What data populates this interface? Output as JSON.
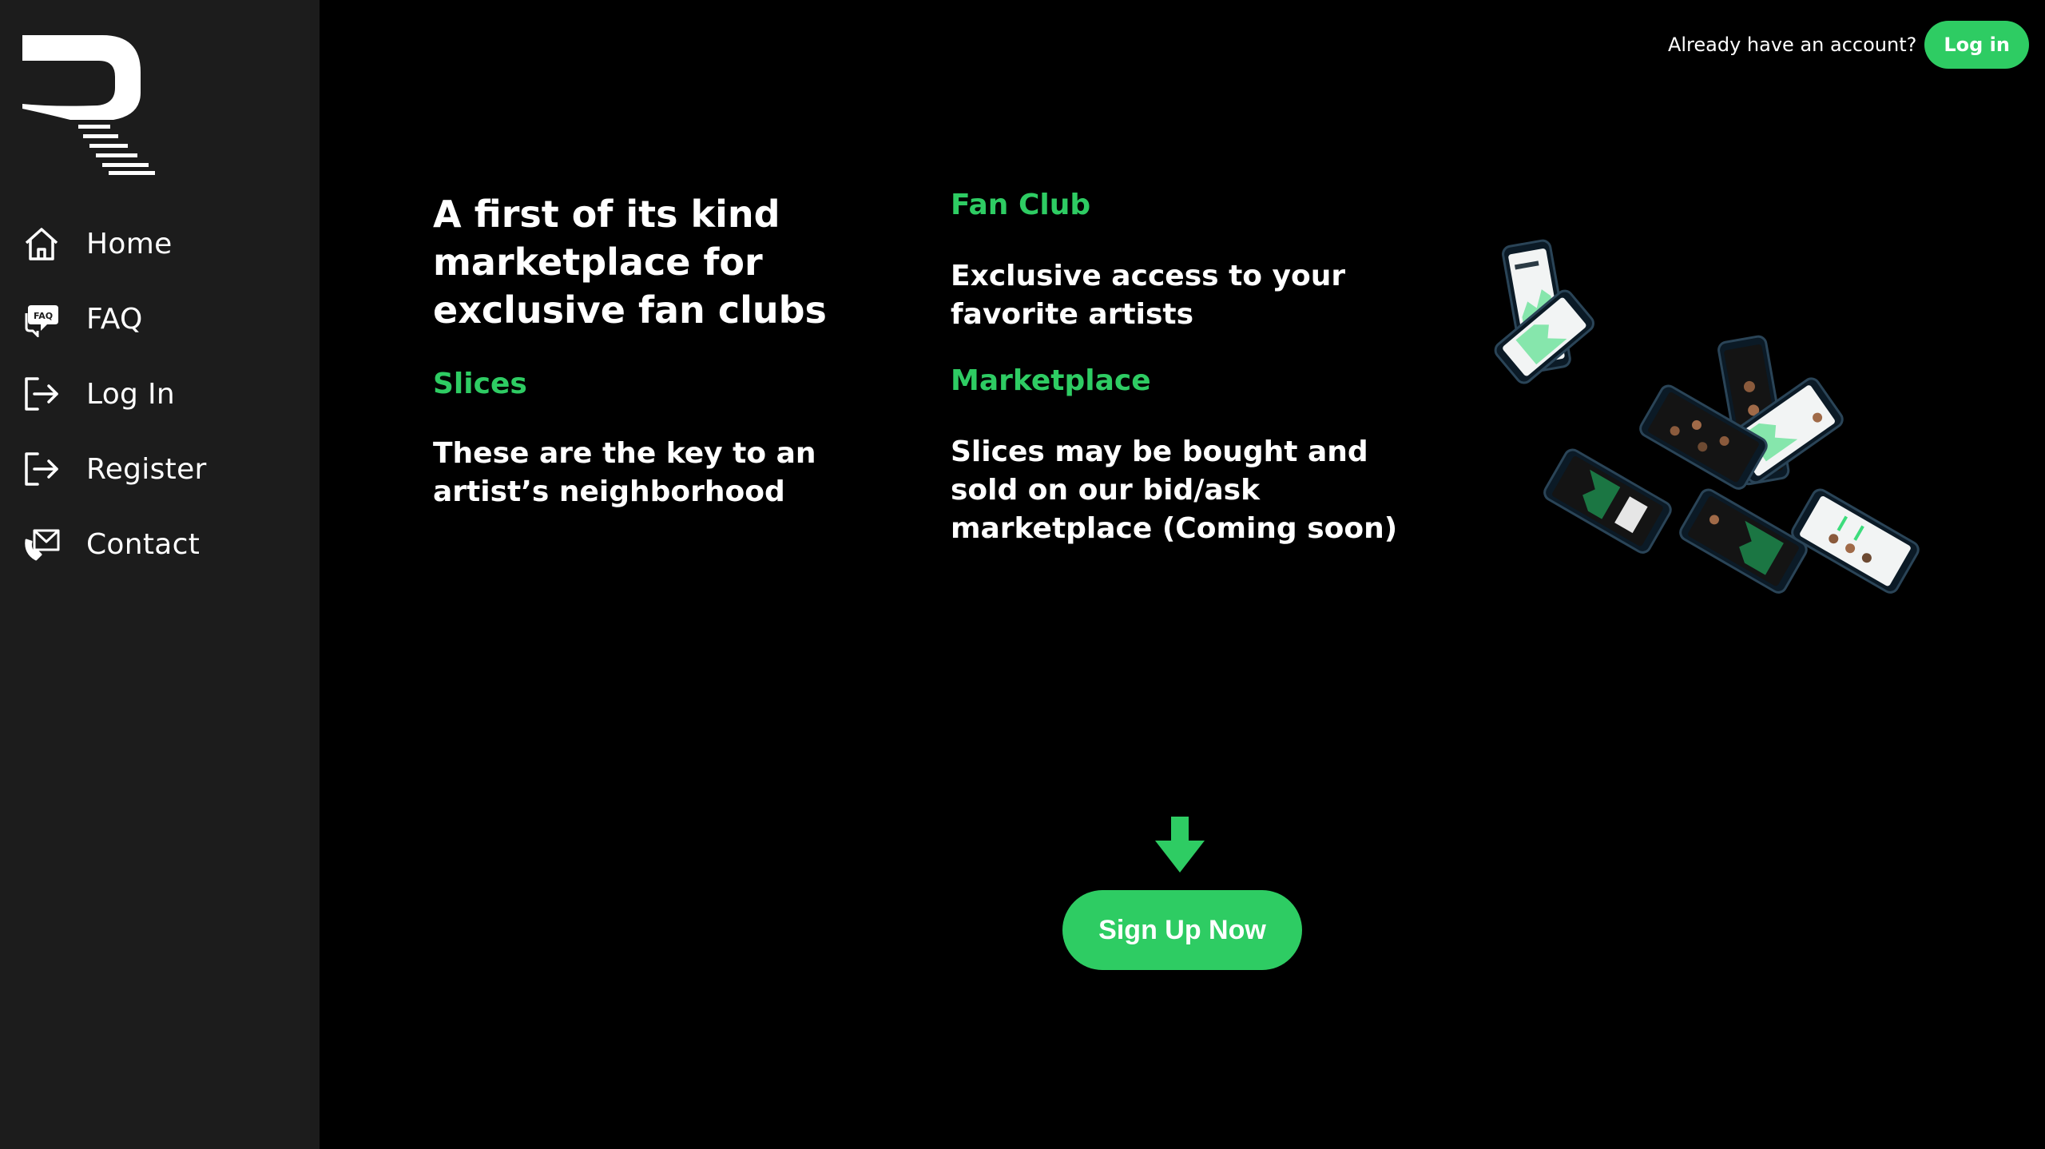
{
  "sidebar": {
    "logo_icon": "r-logo-icon",
    "items": [
      {
        "label": "Home",
        "icon": "home-icon"
      },
      {
        "label": "FAQ",
        "icon": "faq-bubble-icon"
      },
      {
        "label": "Log In",
        "icon": "login-icon"
      },
      {
        "label": "Register",
        "icon": "register-icon"
      },
      {
        "label": "Contact",
        "icon": "contact-mail-icon"
      }
    ]
  },
  "topbar": {
    "prompt": "Already have an account?",
    "login_label": "Log in"
  },
  "hero": {
    "headline": "A first of its kind marketplace for exclusive fan clubs",
    "slices_title": "Slices",
    "slices_body": "These are the key to an artist’s neighborhood",
    "fanclub_title": "Fan Club",
    "fanclub_body": "Exclusive access to your favorite artists",
    "marketplace_title": "Marketplace",
    "marketplace_body": "Slices may be bought and sold on our bid/ask marketplace (Coming soon)"
  },
  "cta": {
    "signup_label": "Sign Up Now",
    "arrow_icon": "arrow-down-icon"
  },
  "colors": {
    "accent": "#2ecc63",
    "sidebar_bg": "#1c1c1c",
    "main_bg": "#000000",
    "text": "#ffffff"
  }
}
